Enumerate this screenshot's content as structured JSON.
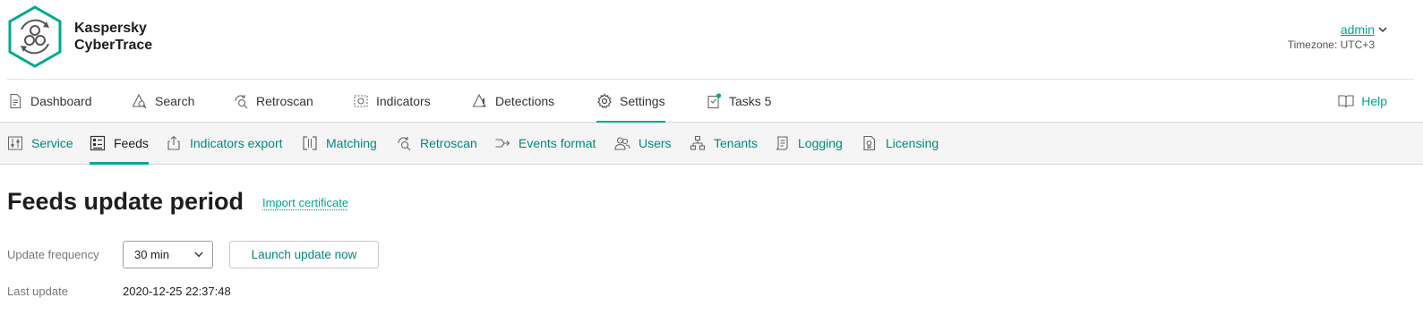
{
  "brand": {
    "line1": "Kaspersky",
    "line2": "CyberTrace",
    "accent": "#00a88e"
  },
  "user": {
    "name": "admin",
    "timezone": "Timezone: UTC+3"
  },
  "main_nav": {
    "items": [
      {
        "label": "Dashboard",
        "icon": "document-icon"
      },
      {
        "label": "Search",
        "icon": "search-triangle-icon"
      },
      {
        "label": "Retroscan",
        "icon": "retroscan-icon"
      },
      {
        "label": "Indicators",
        "icon": "indicators-icon"
      },
      {
        "label": "Detections",
        "icon": "warning-icon"
      },
      {
        "label": "Settings",
        "icon": "gear-icon",
        "active": true
      },
      {
        "label": "Tasks 5",
        "icon": "tasks-clipboard-icon"
      }
    ],
    "help": "Help"
  },
  "sub_nav": {
    "items": [
      {
        "label": "Service",
        "icon": "sliders-icon"
      },
      {
        "label": "Feeds",
        "icon": "feeds-icon",
        "active": true
      },
      {
        "label": "Indicators export",
        "icon": "export-icon"
      },
      {
        "label": "Matching",
        "icon": "matching-icon"
      },
      {
        "label": "Retroscan",
        "icon": "retroscan-icon"
      },
      {
        "label": "Events format",
        "icon": "events-format-icon"
      },
      {
        "label": "Users",
        "icon": "users-icon"
      },
      {
        "label": "Tenants",
        "icon": "tenants-icon"
      },
      {
        "label": "Logging",
        "icon": "logging-icon"
      },
      {
        "label": "Licensing",
        "icon": "licensing-icon"
      }
    ]
  },
  "content": {
    "title": "Feeds update period",
    "import_link": "Import certificate",
    "update_frequency_label": "Update frequency",
    "update_frequency_value": "30 min",
    "launch_button": "Launch update now",
    "last_update_label": "Last update",
    "last_update_value": "2020-12-25 22:37:48"
  }
}
